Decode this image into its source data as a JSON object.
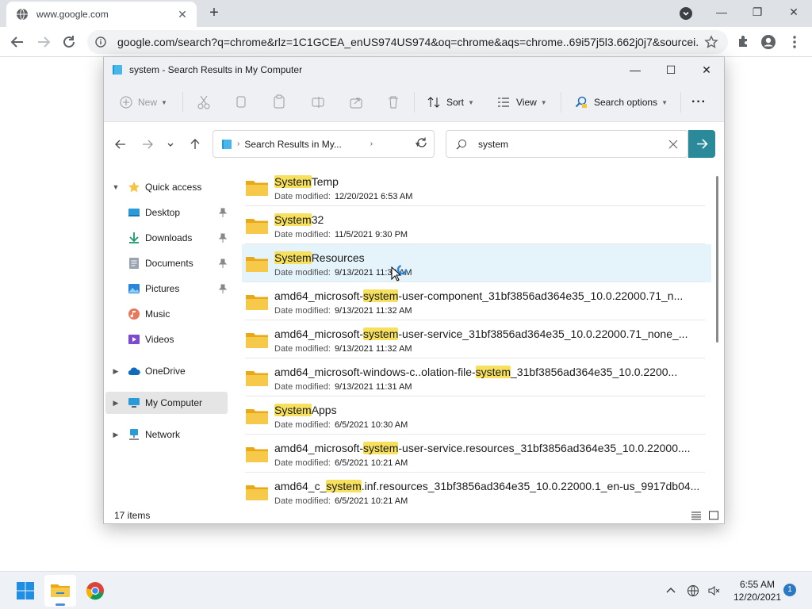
{
  "browser": {
    "tab_title": "www.google.com",
    "url": "google.com/search?q=chrome&rlz=1C1GCEA_enUS974US974&oq=chrome&aqs=chrome..69i57j5l3.662j0j7&sourcei..."
  },
  "explorer": {
    "title": "system - Search Results in My Computer",
    "toolbar": {
      "new": "New",
      "sort": "Sort",
      "view": "View",
      "search_options": "Search options",
      "more": "···"
    },
    "address": "Search Results in My...",
    "search_value": "system",
    "sidebar": {
      "quick_access": "Quick access",
      "desktop": "Desktop",
      "downloads": "Downloads",
      "documents": "Documents",
      "pictures": "Pictures",
      "music": "Music",
      "videos": "Videos",
      "onedrive": "OneDrive",
      "my_computer": "My Computer",
      "network": "Network"
    },
    "date_label": "Date modified:",
    "files": [
      {
        "pre": "",
        "hl": "System",
        "post": "Temp",
        "date": "12/20/2021 6:53 AM"
      },
      {
        "pre": "",
        "hl": "System",
        "post": "32",
        "date": "11/5/2021 9:30 PM"
      },
      {
        "pre": "",
        "hl": "System",
        "post": "Resources",
        "date": "9/13/2021 11:30 AM"
      },
      {
        "pre": "amd64_microsoft-",
        "hl": "system",
        "post": "-user-component_31bf3856ad364e35_10.0.22000.71_n...",
        "date": "9/13/2021 11:32 AM"
      },
      {
        "pre": "amd64_microsoft-",
        "hl": "system",
        "post": "-user-service_31bf3856ad364e35_10.0.22000.71_none_...",
        "date": "9/13/2021 11:32 AM"
      },
      {
        "pre": "amd64_microsoft-windows-c..olation-file-",
        "hl": "system",
        "post": "_31bf3856ad364e35_10.0.2200...",
        "date": "9/13/2021 11:31 AM"
      },
      {
        "pre": "",
        "hl": "System",
        "post": "Apps",
        "date": "6/5/2021 10:30 AM"
      },
      {
        "pre": "amd64_microsoft-",
        "hl": "system",
        "post": "-user-service.resources_31bf3856ad364e35_10.0.22000....",
        "date": "6/5/2021 10:21 AM"
      },
      {
        "pre": "amd64_c_",
        "hl": "system",
        "post": ".inf.resources_31bf3856ad364e35_10.0.22000.1_en-us_9917db04...",
        "date": "6/5/2021 10:21 AM"
      }
    ],
    "status": "17 items"
  },
  "taskbar": {
    "time": "6:55 AM",
    "date": "12/20/2021",
    "notifications": "1"
  },
  "colors": {
    "highlight": "#f6e05e",
    "accent": "#2a8a99",
    "folder": "#f4c542"
  }
}
